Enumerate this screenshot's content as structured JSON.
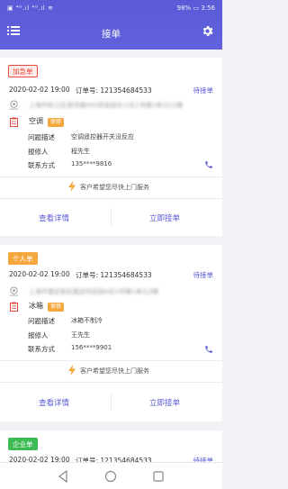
{
  "status_bar": {
    "left": "▣ ⁴ᴳ.ıl ⁴ᴳ.ıl ≋",
    "battery": "98%",
    "time": "3:56"
  },
  "header": {
    "title": "接单",
    "menu_icon": "menu-icon",
    "settings_icon": "gear-icon"
  },
  "colors": {
    "accent": "#5a5ad6",
    "urgent": "#e8483c",
    "personal": "#f4a73c",
    "enterprise": "#3cba54"
  },
  "cards": [
    {
      "badge": "加急单",
      "time": "2020-02-02 19:00",
      "order": "订单号: 121354684533",
      "status": "待接单",
      "address": "上海市松江区泗泾镇450弄金园东小区1号楼1单元11楼",
      "device": "空调",
      "tag": "保修",
      "fields": [
        {
          "label": "问题描述",
          "value": "空调遥控器开关没反应"
        },
        {
          "label": "报修人",
          "value": "程先生"
        },
        {
          "label": "联系方式",
          "value": "135****9816"
        }
      ],
      "notice": "客户希望您尽快上门服务",
      "detail_button": "查看详情",
      "accept_button": "立即接单"
    },
    {
      "badge": "个人单",
      "time": "2020-02-02 19:00",
      "order": "订单号: 121354684533",
      "status": "待接单",
      "address": "上海市嘉定新区嘉定科技园A区2号楼1单元3楼",
      "device": "冰箱",
      "tag": "保修",
      "fields": [
        {
          "label": "问题描述",
          "value": "冰箱不制冷"
        },
        {
          "label": "报修人",
          "value": "王先生"
        },
        {
          "label": "联系方式",
          "value": "156****9901"
        }
      ],
      "notice": "客户希望您尽快上门服务",
      "detail_button": "查看详情",
      "accept_button": "立即接单"
    },
    {
      "badge": "企业单",
      "time": "2020-02-02 19:00",
      "order": "订单号: 121354684533",
      "status": "待接单"
    }
  ]
}
